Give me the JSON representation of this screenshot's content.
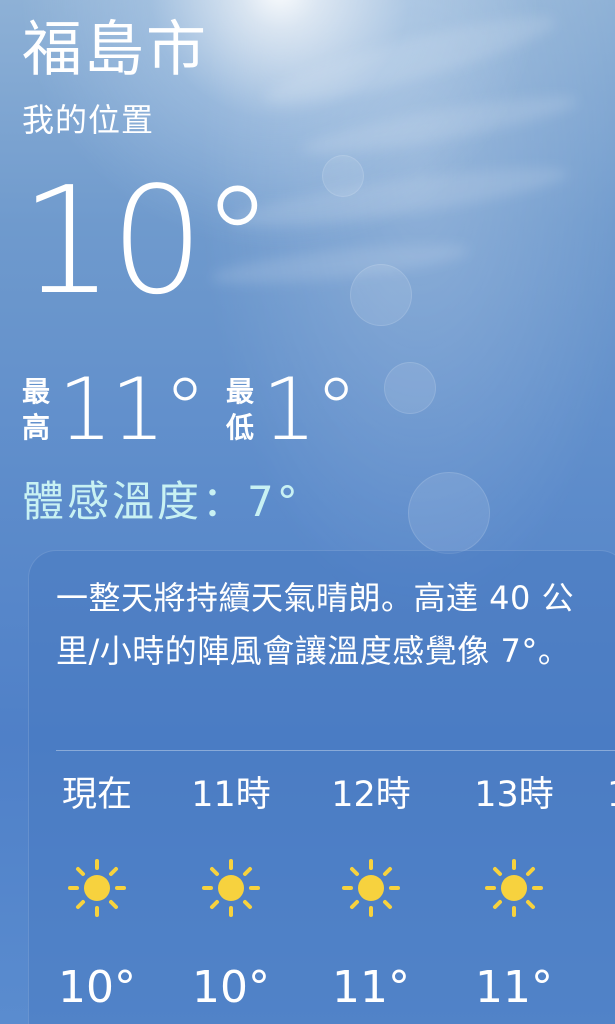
{
  "location": {
    "city": "福島市",
    "subtitle": "我的位置"
  },
  "current": {
    "temperature": "10°",
    "high_label_top": "最",
    "high_label_bottom": "高",
    "high_value": "11°",
    "low_label_top": "最",
    "low_label_bottom": "低",
    "low_value": "1°",
    "feels_like": "體感溫度：7°"
  },
  "forecast": {
    "summary": "一整天將持續天氣晴朗。高達 40 公里/小時的陣風會讓溫度感覺像 7°。",
    "hours": [
      {
        "label": "現在",
        "icon": "sun-icon",
        "temp": "10°"
      },
      {
        "label": "11時",
        "icon": "sun-icon",
        "temp": "10°"
      },
      {
        "label": "12時",
        "icon": "sun-icon",
        "temp": "11°"
      },
      {
        "label": "13時",
        "icon": "sun-icon",
        "temp": "11°"
      }
    ],
    "partial_next_label": "1"
  },
  "colors": {
    "feels_like_text": "#c8f1f3",
    "sun_icon": "#f7d23e",
    "card_bg": "rgba(70,120,190,0.42)"
  }
}
